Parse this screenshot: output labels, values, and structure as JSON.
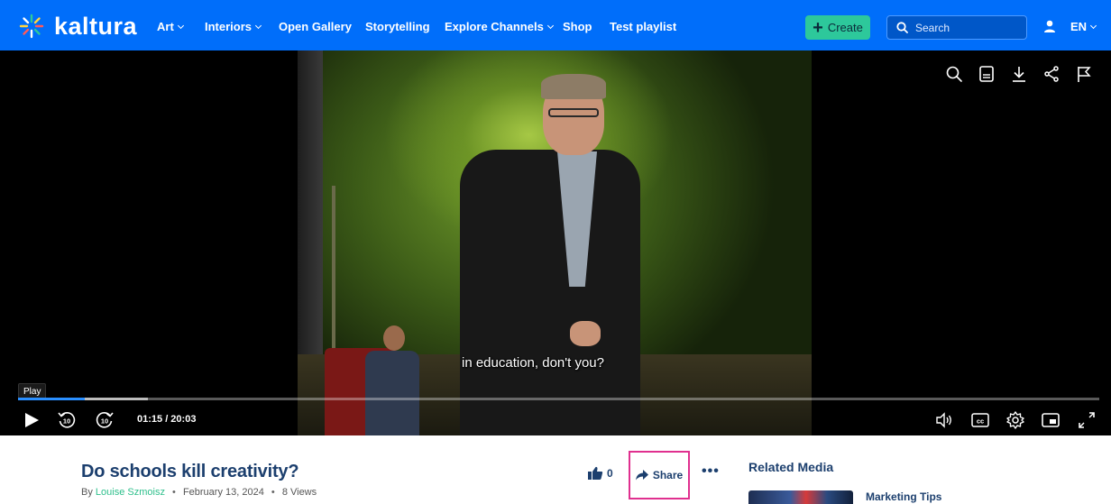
{
  "brand": {
    "name": "kaltura",
    "accent": "#006efa",
    "create_color": "#2dc89b"
  },
  "nav": {
    "items": [
      {
        "label": "Art",
        "has_dropdown": true
      },
      {
        "label": "Interiors",
        "has_dropdown": true
      },
      {
        "label": "Open Gallery",
        "has_dropdown": false
      },
      {
        "label": "Storytelling",
        "has_dropdown": false
      },
      {
        "label": "Explore Channels",
        "has_dropdown": true
      },
      {
        "label": "Shop",
        "has_dropdown": false
      },
      {
        "label": "Test playlist",
        "has_dropdown": false
      }
    ],
    "create_label": "Create",
    "search_placeholder": "Search",
    "language": "EN"
  },
  "player": {
    "caption": "in education, don't you?",
    "tooltip": "Play",
    "current_time": "01:15",
    "duration": "20:03",
    "time_display": "01:15 / 20:03",
    "progress_fraction": 0.062,
    "buffered_fraction": 0.12,
    "top_icons": [
      "search-icon",
      "transcript-icon",
      "download-icon",
      "share-icon",
      "flag-icon"
    ],
    "bottom_icons": [
      "play-icon",
      "rewind-10-icon",
      "forward-10-icon",
      "volume-icon",
      "cc-icon",
      "settings-icon",
      "picture-in-picture-icon",
      "fullscreen-icon"
    ]
  },
  "media": {
    "title": "Do schools kill creativity?",
    "by_prefix": "By",
    "author": "Louise Szmoisz",
    "date": "February 13, 2024",
    "views": "8 Views",
    "likes": "0",
    "share_label": "Share",
    "more_label": "•••"
  },
  "related": {
    "heading": "Related Media",
    "items": [
      {
        "title": "Marketing Tips"
      }
    ]
  }
}
